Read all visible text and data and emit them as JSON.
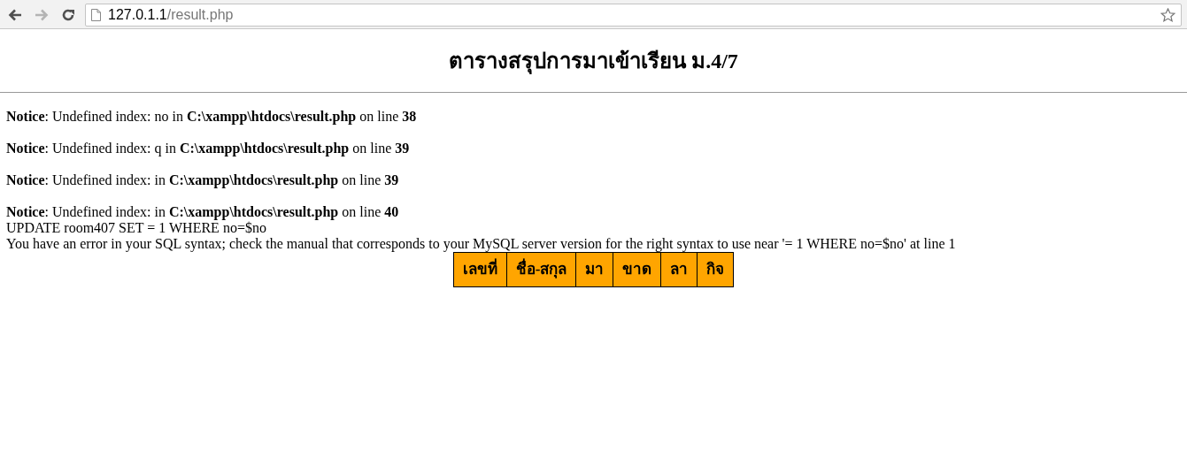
{
  "browser": {
    "back_disabled": false,
    "forward_disabled": true,
    "url_host": "127.0.1.1",
    "url_path": "/result.php"
  },
  "title": "ตารางสรุปการมาเข้าเรียน ม.4/7",
  "notices": [
    "**Notice**: Undefined index: no in **C:\\xampp\\htdocs\\result.php** on line **38**",
    "**Notice**: Undefined index: q in **C:\\xampp\\htdocs\\result.php** on line **39**",
    "**Notice**: Undefined index: in **C:\\xampp\\htdocs\\result.php** on line **39**",
    "**Notice**: Undefined index: in **C:\\xampp\\htdocs\\result.php** on line **40**"
  ],
  "query": "UPDATE room407 SET = 1 WHERE no=$no",
  "error": "You have an error in your SQL syntax; check the manual that corresponds to your MySQL server version for the right syntax to use near '= 1 WHERE no=$no' at line 1",
  "table": {
    "columns": [
      "เลขที่",
      "ชื่อ-สกุล",
      "มา",
      "ขาด",
      "ลา",
      "กิจ"
    ]
  }
}
